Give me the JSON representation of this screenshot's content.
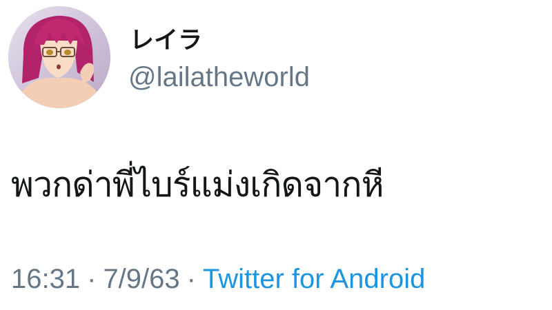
{
  "user": {
    "display_name": "レイラ",
    "handle": "@lailatheworld",
    "avatar_icon": "anime-girl-avatar"
  },
  "tweet": {
    "text": "พวกด่าพี่ไบร์แม่งเกิดจากหี",
    "time": "16:31",
    "date": "7/9/63",
    "separator": "·",
    "source": "Twitter for Android"
  },
  "colors": {
    "text_primary": "#14171a",
    "text_secondary": "#657786",
    "link": "#1b95e0"
  }
}
